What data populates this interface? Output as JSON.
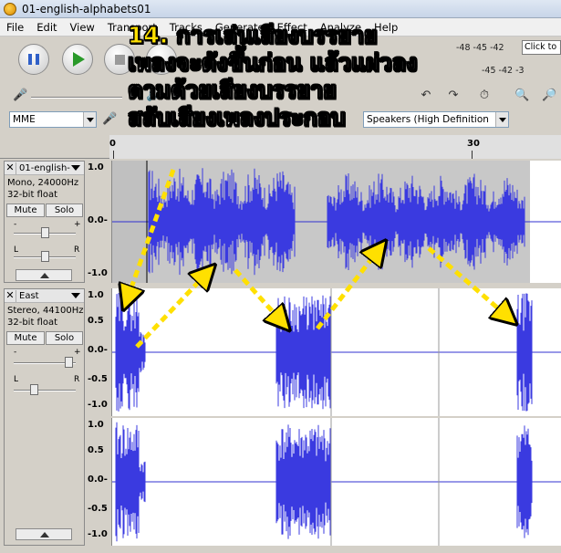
{
  "window": {
    "title": "01-english-alphabets01"
  },
  "menu": [
    "File",
    "Edit",
    "View",
    "Transport",
    "Tracks",
    "Generate",
    "Effect",
    "Analyze",
    "Help"
  ],
  "toolbar": {
    "pause_icon": "pause-icon",
    "play_icon": "play-icon",
    "stop_icon": "stop-icon",
    "meter_scale": "-48 -45 -42",
    "meter_scale2": "-45 -42 -3",
    "click_to_start": "Click to Start Monitoring",
    "host": "MME",
    "playback_device": "Speakers (High Definition Audio"
  },
  "ruler": {
    "ticks": [
      "0",
      "30"
    ]
  },
  "tracks": [
    {
      "name": "01-english-",
      "rate": "Mono, 24000Hz",
      "format": "32-bit float",
      "mute_label": "Mute",
      "solo_label": "Solo",
      "left_label": "L",
      "right_label": "R",
      "minus_label": "-",
      "plus_label": "+",
      "scale": [
        "1.0",
        "0.0-",
        "-1.0"
      ]
    },
    {
      "name": "East",
      "rate": "Stereo, 44100Hz",
      "format": "32-bit float",
      "mute_label": "Mute",
      "solo_label": "Solo",
      "left_label": "L",
      "right_label": "R",
      "minus_label": "-",
      "plus_label": "+",
      "scale": [
        "1.0",
        "0.5",
        "0.0-",
        "-0.5",
        "-1.0"
      ],
      "scale2": [
        "1.0",
        "0.5",
        "0.0-",
        "-0.5",
        "-1.0"
      ]
    }
  ],
  "caption": {
    "number": "14.",
    "line1": "การเล่นเสียงบรรยาย",
    "line2": "เพลงจะดังขึ้นก่อน แล้วแผ่วลง",
    "line3": "ตามด้วยเสียงบรรยาย",
    "line4": "สลับเสียงเพลงประกอบ"
  }
}
